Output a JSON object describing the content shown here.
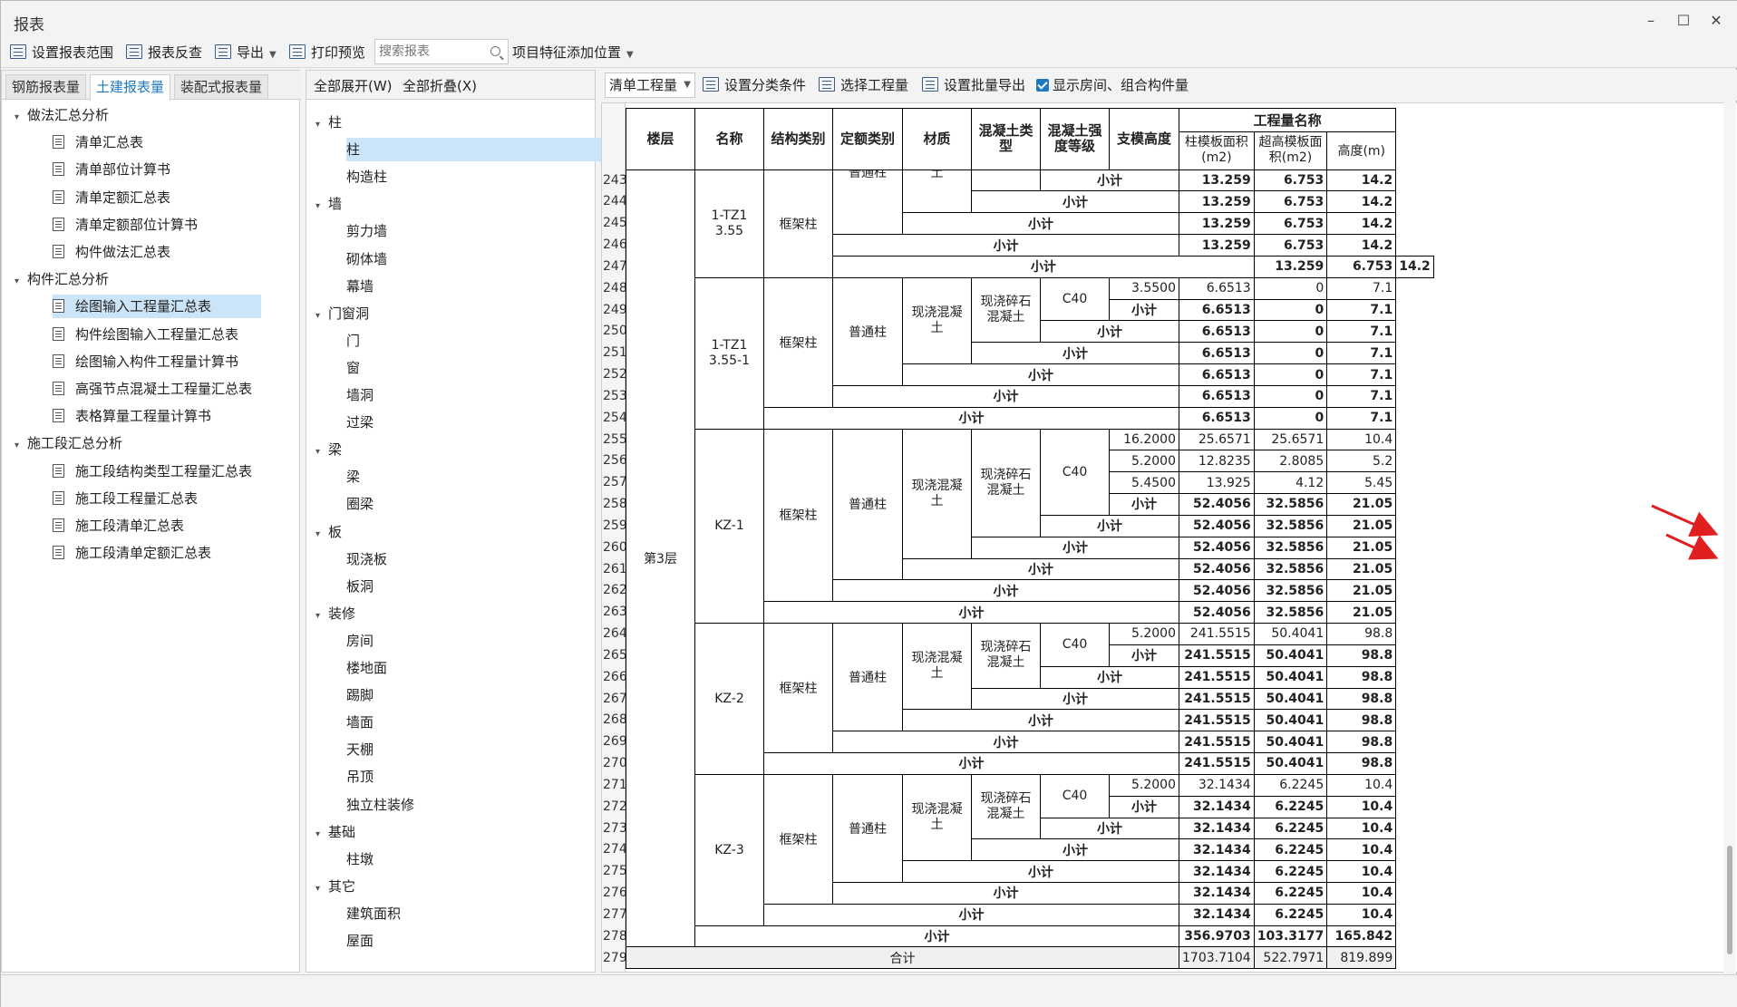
{
  "window": {
    "title": "报表"
  },
  "toolbar": {
    "set_scope": "设置报表范围",
    "check": "报表反查",
    "export": "导出",
    "print_preview": "打印预览",
    "search_placeholder": "搜索报表",
    "feature_pos": "项目特征添加位置"
  },
  "left_tabs": [
    "钢筋报表量",
    "土建报表量",
    "装配式报表量"
  ],
  "left_tree": [
    {
      "label": "做法汇总分析",
      "level": 0
    },
    {
      "label": "清单汇总表",
      "level": 1
    },
    {
      "label": "清单部位计算书",
      "level": 1
    },
    {
      "label": "清单定额汇总表",
      "level": 1
    },
    {
      "label": "清单定额部位计算书",
      "level": 1
    },
    {
      "label": "构件做法汇总表",
      "level": 1
    },
    {
      "label": "构件汇总分析",
      "level": 0
    },
    {
      "label": "绘图输入工程量汇总表",
      "level": 1,
      "selected": true
    },
    {
      "label": "构件绘图输入工程量汇总表",
      "level": 1
    },
    {
      "label": "绘图输入构件工程量计算书",
      "level": 1
    },
    {
      "label": "高强节点混凝土工程量汇总表",
      "level": 1
    },
    {
      "label": "表格算量工程量计算书",
      "level": 1
    },
    {
      "label": "施工段汇总分析",
      "level": 0
    },
    {
      "label": "施工段结构类型工程量汇总表",
      "level": 1
    },
    {
      "label": "施工段工程量汇总表",
      "level": 1
    },
    {
      "label": "施工段清单汇总表",
      "level": 1
    },
    {
      "label": "施工段清单定额汇总表",
      "level": 1
    }
  ],
  "mid_top": {
    "expand": "全部展开(W)",
    "collapse": "全部折叠(X)"
  },
  "mid_tree": [
    {
      "label": "柱",
      "level": 0
    },
    {
      "label": "柱",
      "level": 1,
      "selected": true
    },
    {
      "label": "构造柱",
      "level": 1
    },
    {
      "label": "墙",
      "level": 0
    },
    {
      "label": "剪力墙",
      "level": 1
    },
    {
      "label": "砌体墙",
      "level": 1
    },
    {
      "label": "幕墙",
      "level": 1
    },
    {
      "label": "门窗洞",
      "level": 0
    },
    {
      "label": "门",
      "level": 1
    },
    {
      "label": "窗",
      "level": 1
    },
    {
      "label": "墙洞",
      "level": 1
    },
    {
      "label": "过梁",
      "level": 1
    },
    {
      "label": "梁",
      "level": 0
    },
    {
      "label": "梁",
      "level": 1
    },
    {
      "label": "圈梁",
      "level": 1
    },
    {
      "label": "板",
      "level": 0
    },
    {
      "label": "现浇板",
      "level": 1
    },
    {
      "label": "板洞",
      "level": 1
    },
    {
      "label": "装修",
      "level": 0
    },
    {
      "label": "房间",
      "level": 1
    },
    {
      "label": "楼地面",
      "level": 1
    },
    {
      "label": "踢脚",
      "level": 1
    },
    {
      "label": "墙面",
      "level": 1
    },
    {
      "label": "天棚",
      "level": 1
    },
    {
      "label": "吊顶",
      "level": 1
    },
    {
      "label": "独立柱装修",
      "level": 1
    },
    {
      "label": "基础",
      "level": 0
    },
    {
      "label": "柱墩",
      "level": 1
    },
    {
      "label": "其它",
      "level": 0
    },
    {
      "label": "建筑面积",
      "level": 1
    },
    {
      "label": "屋面",
      "level": 1
    }
  ],
  "right_top": {
    "combo": "清单工程量",
    "set_cat": "设置分类条件",
    "select_qty": "选择工程量",
    "batch_export": "设置批量导出",
    "show_room": "显示房间、组合构件量"
  },
  "table": {
    "headers": {
      "floor": "楼层",
      "name": "名称",
      "struct": "结构类别",
      "quota": "定额类别",
      "material": "材质",
      "concrete_type": "混凝土类型",
      "strength": "混凝土强度等级",
      "height": "支模高度",
      "qty_group": "工程量名称",
      "c1": "柱模板面积(m2)",
      "c2": "超高模板面积(m2)",
      "c3": "高度(m)"
    },
    "floor": "第3层",
    "row_numbers": [
      "243",
      "244",
      "245",
      "246",
      "247",
      "248",
      "249",
      "250",
      "251",
      "252",
      "253",
      "254",
      "255",
      "256",
      "257",
      "258",
      "259",
      "260",
      "261",
      "262",
      "263",
      "264",
      "265",
      "266",
      "267",
      "268",
      "269",
      "270",
      "271",
      "272",
      "273",
      "274",
      "275",
      "276",
      "277",
      "278",
      "279"
    ],
    "names": [
      "1-TZ1 3.55",
      "1-TZ1 3.55-1",
      "KZ-1",
      "KZ-2",
      "KZ-3"
    ],
    "struct": "框架柱",
    "quota": "普通柱",
    "quota_clip": "普通柱",
    "material": "现浇混凝土",
    "material_clip": "土",
    "concrete": "现浇碎石混凝土",
    "grade": "C40",
    "subtotal": "小计",
    "total": "合计",
    "g1": [
      [
        "13.259",
        "6.753",
        "14.2"
      ],
      [
        "13.259",
        "6.753",
        "14.2"
      ],
      [
        "13.259",
        "6.753",
        "14.2"
      ],
      [
        "13.259",
        "6.753",
        "14.2"
      ],
      [
        "13.259",
        "6.753",
        "14.2"
      ]
    ],
    "g2": {
      "height": "3.5500",
      "rows": [
        [
          "6.6513",
          "0",
          "7.1"
        ],
        [
          "6.6513",
          "0",
          "7.1"
        ],
        [
          "6.6513",
          "0",
          "7.1"
        ],
        [
          "6.6513",
          "0",
          "7.1"
        ],
        [
          "6.6513",
          "0",
          "7.1"
        ],
        [
          "6.6513",
          "0",
          "7.1"
        ],
        [
          "6.6513",
          "0",
          "7.1"
        ]
      ]
    },
    "g3": {
      "heights": [
        "16.2000",
        "5.2000",
        "5.4500"
      ],
      "detail": [
        [
          "25.6571",
          "25.6571",
          "10.4"
        ],
        [
          "12.8235",
          "2.8085",
          "5.2"
        ],
        [
          "13.925",
          "4.12",
          "5.45"
        ]
      ],
      "sub": [
        [
          "52.4056",
          "32.5856",
          "21.05"
        ],
        [
          "52.4056",
          "32.5856",
          "21.05"
        ],
        [
          "52.4056",
          "32.5856",
          "21.05"
        ],
        [
          "52.4056",
          "32.5856",
          "21.05"
        ],
        [
          "52.4056",
          "32.5856",
          "21.05"
        ],
        [
          "52.4056",
          "32.5856",
          "21.05"
        ]
      ]
    },
    "g4": {
      "height": "5.2000",
      "detail": [
        "241.5515",
        "50.4041",
        "98.8"
      ],
      "sub": [
        [
          "241.5515",
          "50.4041",
          "98.8"
        ],
        [
          "241.5515",
          "50.4041",
          "98.8"
        ],
        [
          "241.5515",
          "50.4041",
          "98.8"
        ],
        [
          "241.5515",
          "50.4041",
          "98.8"
        ],
        [
          "241.5515",
          "50.4041",
          "98.8"
        ],
        [
          "241.5515",
          "50.4041",
          "98.8"
        ]
      ]
    },
    "g5": {
      "height": "5.2000",
      "detail": [
        "32.1434",
        "6.2245",
        "10.4"
      ],
      "sub": [
        [
          "32.1434",
          "6.2245",
          "10.4"
        ],
        [
          "32.1434",
          "6.2245",
          "10.4"
        ],
        [
          "32.1434",
          "6.2245",
          "10.4"
        ],
        [
          "32.1434",
          "6.2245",
          "10.4"
        ],
        [
          "32.1434",
          "6.2245",
          "10.4"
        ],
        [
          "32.1434",
          "6.2245",
          "10.4"
        ]
      ]
    },
    "floor_sub": [
      "356.9703",
      "103.3177",
      "165.842"
    ],
    "grand": [
      "1703.7104",
      "522.7971",
      "819.899"
    ]
  }
}
